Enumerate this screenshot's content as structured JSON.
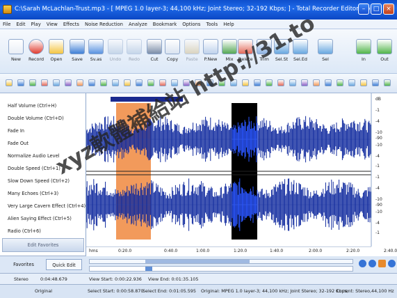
{
  "window": {
    "title": "C:\\Sarah McLachlan-Trust.mp3 - [ MPEG 1.0 layer-3; 44,100 kHz; Joint Stereo; 32-192 Kbps;  ] - Total Recorder Editor Pro",
    "minimize": "–",
    "maximize": "□",
    "close": "×"
  },
  "menu": [
    "File",
    "Edit",
    "Play",
    "View",
    "Effects",
    "Noise Reduction",
    "Analyze",
    "Bookmark",
    "Options",
    "Tools",
    "Help"
  ],
  "toolbar": [
    {
      "label": "New",
      "icon": "new-doc-icon",
      "color": "#e9eef6",
      "disabled": false
    },
    {
      "label": "Record",
      "icon": "record-icon",
      "color": "#e03c2f",
      "disabled": false
    },
    {
      "label": "Open",
      "icon": "folder-icon",
      "color": "#f4c542",
      "disabled": false
    },
    {
      "label": "Save",
      "icon": "save-icon",
      "color": "#3f7fd6",
      "disabled": false
    },
    {
      "label": "Sv.as",
      "icon": "save-as-icon",
      "color": "#5a93e0",
      "disabled": false
    },
    {
      "label": "Undo",
      "icon": "undo-icon",
      "color": "#9db6d6",
      "disabled": true
    },
    {
      "label": "Redo",
      "icon": "redo-icon",
      "color": "#9db6d6",
      "disabled": true
    },
    {
      "label": "Cut",
      "icon": "scissors-icon",
      "color": "#7b8da8",
      "disabled": false
    },
    {
      "label": "Copy",
      "icon": "copy-icon",
      "color": "#d9e3f0",
      "disabled": false
    },
    {
      "label": "Paste",
      "icon": "paste-icon",
      "color": "#c9b27a",
      "disabled": true
    },
    {
      "label": "P.New",
      "icon": "paste-new-icon",
      "color": "#bfd2ec",
      "disabled": false
    },
    {
      "label": "Mix",
      "icon": "mix-icon",
      "color": "#55a855",
      "disabled": false
    },
    {
      "label": "Delete",
      "icon": "delete-icon",
      "color": "#e36a5a",
      "disabled": false
    },
    {
      "label": "Trim",
      "icon": "trim-icon",
      "color": "#8fb2e0",
      "disabled": false
    },
    {
      "label": "Sel.St",
      "icon": "select-start-icon",
      "color": "#69a8e0",
      "disabled": false
    },
    {
      "label": "Sel.Ed",
      "icon": "select-end-icon",
      "color": "#69a8e0",
      "disabled": false
    },
    {
      "label": "Sel",
      "icon": "select-icon",
      "color": "#69a8e0",
      "disabled": false
    },
    {
      "label": "In",
      "icon": "zoom-in-icon",
      "color": "#52b54a",
      "disabled": false
    },
    {
      "label": "Out",
      "icon": "zoom-out-icon",
      "color": "#52b54a",
      "disabled": false
    }
  ],
  "effects": [
    "Half Volume (Ctrl+H)",
    "Double Volume (Ctrl+D)",
    "Fade In",
    "Fade Out",
    "Normalize Audio Level",
    "Double Speed (Ctrl+1)",
    "Slow Down Speed (Ctrl+2)",
    "Many Echoes (Ctrl+3)",
    "Very Large Cavern Effect (Ctrl+4)",
    "Alien Saying Effect (Ctrl+5)",
    "Radio (Ctrl+6)"
  ],
  "edit_favorites": "Edit Favorites",
  "tabs": {
    "favorites": "Favorites",
    "quick_edit": "Quick Edit"
  },
  "db_labels": [
    "dB",
    "-1",
    "-4",
    "-10",
    "-90",
    "-10",
    "-4",
    "-1"
  ],
  "time_labels": [
    "hms",
    "0:20.0",
    "0:40.0",
    "1:00.0",
    "1:20.0",
    "1:40.0",
    "2:00.0",
    "2:20.0",
    "2:40.0"
  ],
  "status": {
    "mode": "Stereo",
    "position": "0:04:48.679",
    "view_start": "View Start: 0:00:22.936",
    "view_end": "View End: 0:01:35.105",
    "format": "Original",
    "sel_start": "Select Start: 0:00:58.870",
    "sel_end": "Select End: 0:01:05.595",
    "original_info": "Original: MPEG 1.0 layer-3; 44,100 kHz; Joint Stereo; 32-192 Kbps;",
    "current_info": "Current: Stereo,44,100 Hz"
  },
  "watermark": {
    "text": "xyz軟體補給站 http://31.to"
  },
  "colors": {
    "wave": "#102a9e",
    "wave_selected": "#2a56ff",
    "orange_region": "#f29a5b",
    "selection": "#000000"
  }
}
